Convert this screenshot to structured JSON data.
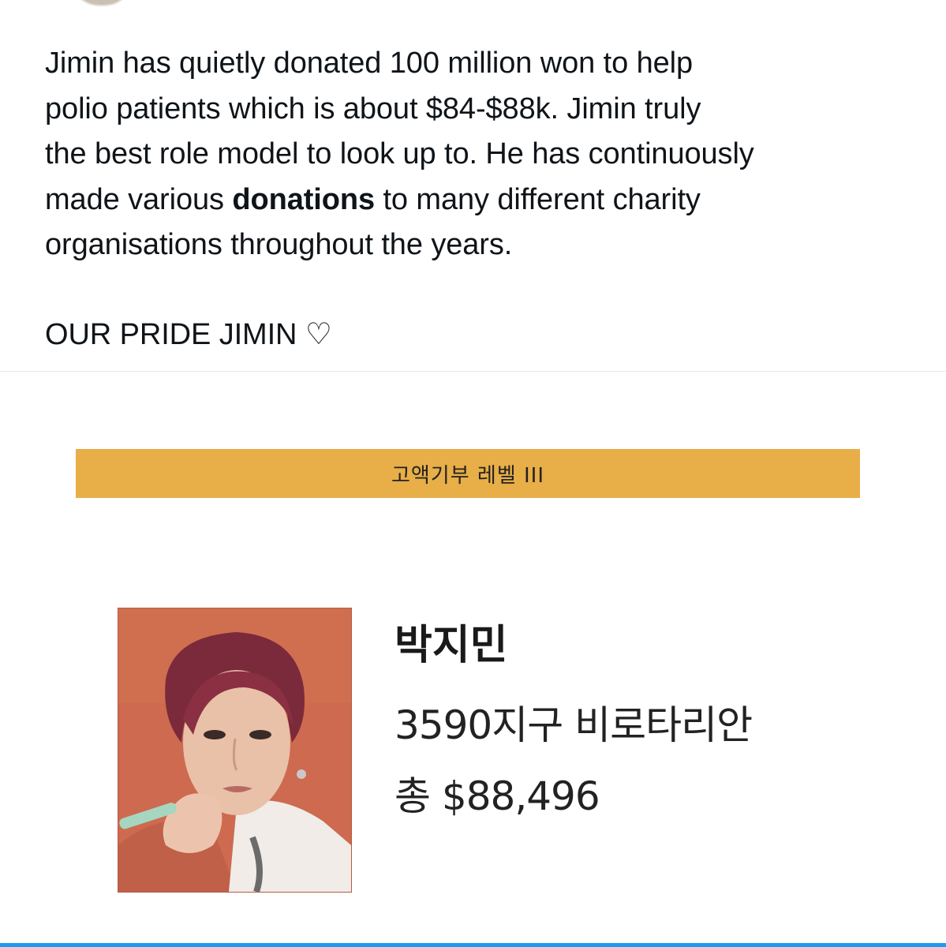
{
  "tweet": {
    "line1": "Jimin has quietly donated 100 million won to help",
    "line2": "polio patients which is about $84-$88k. Jimin truly",
    "line3": "the best role model to look up to. He has continuously",
    "line4_before": "made various ",
    "line4_bold": "donations",
    "line4_after": " to many different charity",
    "line5": "organisations throughout the years.",
    "signoff": "OUR PRIDE JIMIN ♡"
  },
  "media": {
    "banner_label": "고액기부 레벨 III",
    "donor_name": "박지민",
    "donor_club": "3590지구 비로타리안",
    "donor_total": "총 $88,496"
  },
  "colors": {
    "banner": "#e8ae47",
    "photo_background": "#cf6b50",
    "accent": "#1d9bf0",
    "divider": "#e1e8ed"
  }
}
